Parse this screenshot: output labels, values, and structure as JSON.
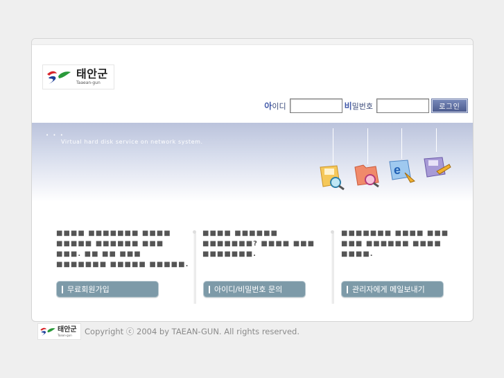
{
  "brand": {
    "name_ko": "태안군",
    "name_en": "Taaean-gun"
  },
  "login": {
    "id_label_strong": "아",
    "id_label_rest": "이디",
    "pw_label_strong": "비",
    "pw_label_rest": "밀번호",
    "button_label": "로그인",
    "id_value": "",
    "pw_value": ""
  },
  "banner": {
    "dots": "• • •",
    "tagline": "Virtual hard disk service on network system.",
    "icons": [
      "disk-search-icon",
      "folder-search-icon",
      "ie-browser-icon",
      "disk-edit-icon"
    ]
  },
  "sections": [
    {
      "text": "■■■■ ■■■■■■■ ■■■■ ■■■■■ ■■■■■■ ■■■ ■■■. ■■ ■■ ■■■ ■■■■■■■ ■■■■■ ■■■■■.",
      "button": "무료회원가입"
    },
    {
      "text": "■■■■ ■■■■■■ ■■■■■■■? ■■■■ ■■■ ■■■■■■■.",
      "button": "아이디/비밀번호 문의"
    },
    {
      "text": "■■■■■■■ ■■■■ ■■■ ■■■ ■■■■■■ ■■■■ ■■■■.",
      "button": "관리자에게 메일보내기"
    }
  ],
  "footer": {
    "logo_ko": "태안군",
    "logo_en": "Taaan-gun",
    "copyright": "Copyright ⓒ 2004 by TAEAN-GUN. All rights reserved."
  },
  "colors": {
    "accent": "#3f57a8",
    "button": "#7d9aa8",
    "banner": "#bbc3dc"
  }
}
